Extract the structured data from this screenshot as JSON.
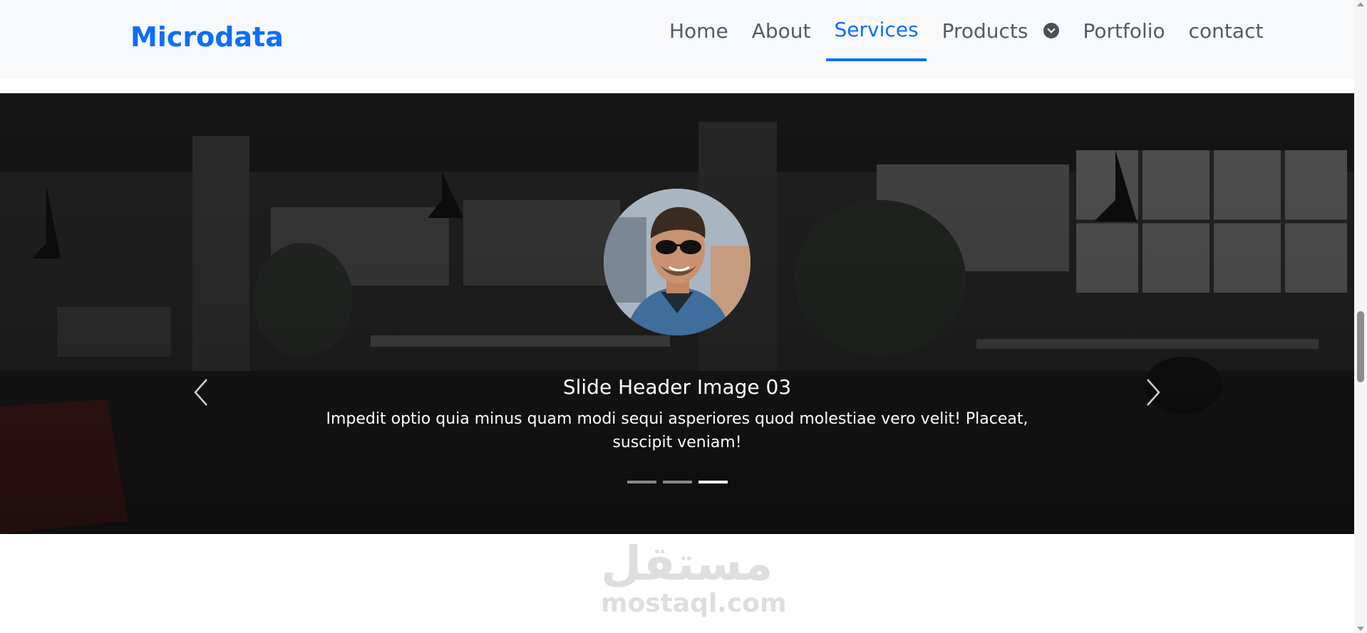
{
  "navbar": {
    "brand": "Microdata",
    "items": [
      {
        "label": "Home",
        "active": false
      },
      {
        "label": "About",
        "active": false
      },
      {
        "label": "Services",
        "active": true
      },
      {
        "label": "Products",
        "active": false,
        "dropdown": true
      },
      {
        "label": "Portfolio",
        "active": false
      },
      {
        "label": "contact",
        "active": false
      }
    ]
  },
  "carousel": {
    "slide_title": "Slide Header Image 03",
    "slide_text": "Impedit optio quia minus quam modi sequi asperiores quod molestiae vero velit! Placeat, suscipit veniam!",
    "indicator_count": 3,
    "active_index": 2,
    "prev_icon": "chevron-left-icon",
    "next_icon": "chevron-right-icon"
  },
  "watermark": {
    "arabic": "مستقل",
    "latin": "mostaql.com"
  },
  "colors": {
    "brand": "#0d6efd",
    "nav_text": "#555b61",
    "navbar_bg": "#f8f9fa",
    "watermark": "#dedede"
  }
}
